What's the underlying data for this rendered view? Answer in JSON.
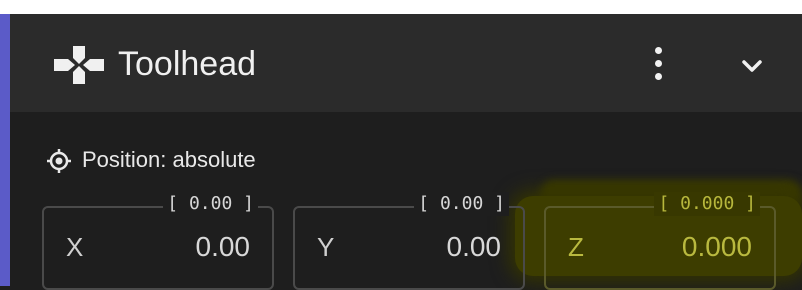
{
  "panel": {
    "title": "Toolhead",
    "title_icon": "gamepad-dpad-icon",
    "menu_icon": "more-vertical-icon",
    "collapse_icon": "chevron-down-icon",
    "accent_color": "#5b5bc8"
  },
  "position": {
    "icon": "crosshair-icon",
    "label": "Position: absolute"
  },
  "axes": [
    {
      "axis": "X",
      "hint": "[ 0.00 ]",
      "value": "0.00"
    },
    {
      "axis": "Y",
      "hint": "[ 0.00 ]",
      "value": "0.00"
    },
    {
      "axis": "Z",
      "hint": "[ 0.000 ]",
      "value": "0.000",
      "highlight_color": "#b9b93f"
    }
  ]
}
